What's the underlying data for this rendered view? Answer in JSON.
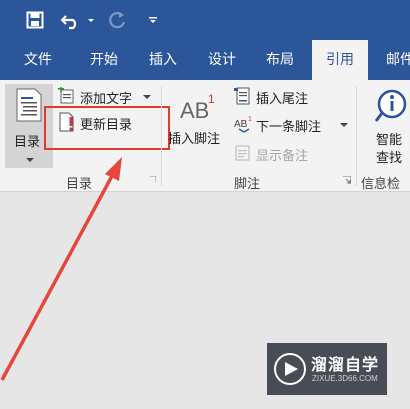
{
  "quick_access": {
    "save_icon": "save-icon",
    "undo_icon": "undo-icon",
    "redo_icon": "redo-icon",
    "customize_icon": "customize-qat-icon"
  },
  "tabs": [
    {
      "label": "文件"
    },
    {
      "label": "开始"
    },
    {
      "label": "插入"
    },
    {
      "label": "设计"
    },
    {
      "label": "布局"
    },
    {
      "label": "引用",
      "active": true
    },
    {
      "label": "邮件"
    }
  ],
  "ribbon": {
    "toc_group": {
      "toc_button": "目录",
      "add_text": "添加文字",
      "update_toc": "更新目录",
      "group_label": "目录"
    },
    "footnote_group": {
      "insert_footnote": "插入脚注",
      "ab_mark": "AB",
      "ab_sup": "1",
      "insert_endnote": "插入尾注",
      "next_footnote": "下一条脚注",
      "show_notes": "显示备注",
      "group_label": "脚注"
    },
    "research_group": {
      "smart_lookup_line1": "智能",
      "smart_lookup_line2": "查找",
      "group_label": "信息检索"
    }
  },
  "watermark": {
    "brand": "溜溜自学",
    "url": "ZIXUE.3D66.COM"
  },
  "colors": {
    "accent": "#2b579a",
    "highlight": "#e03a2f",
    "arrow": "#e8453c"
  }
}
